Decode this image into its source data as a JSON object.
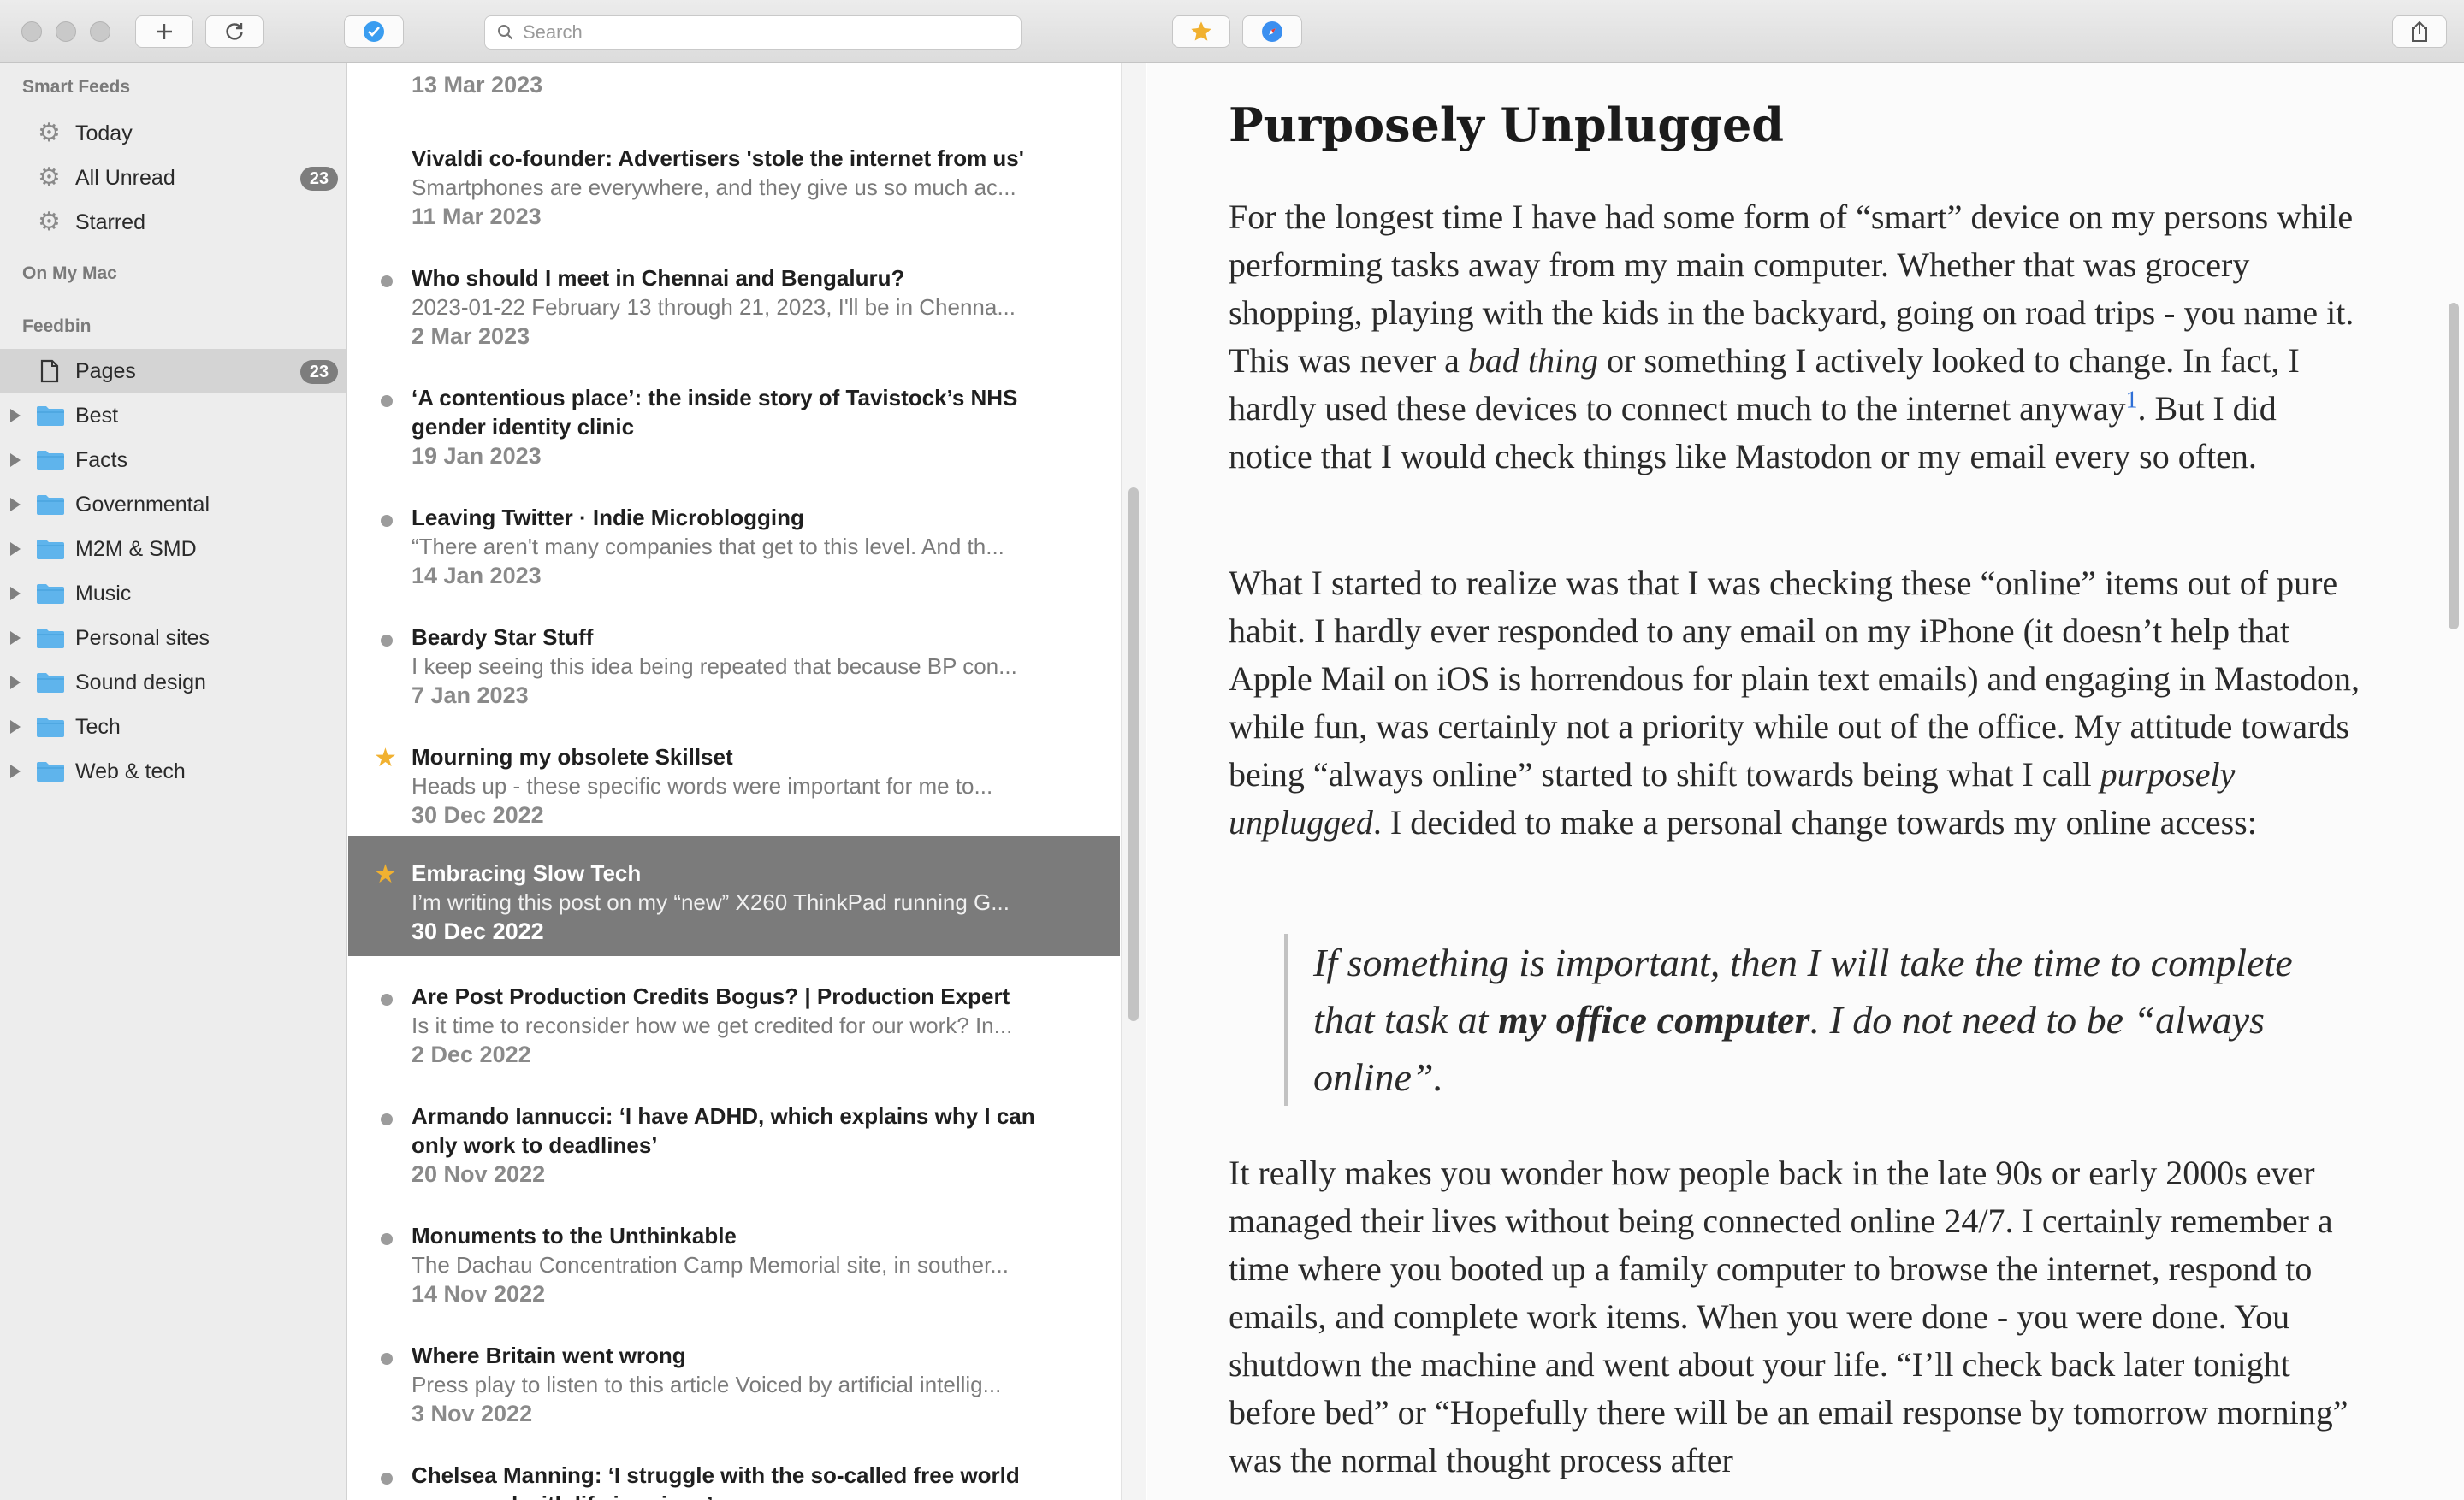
{
  "toolbar": {
    "search_placeholder": "Search",
    "new_icon": "plus-icon",
    "refresh_icon": "refresh-icon",
    "mark_read_icon": "checkmark-circle-icon",
    "star_icon": "star-icon",
    "safari_icon": "compass-icon",
    "share_icon": "share-icon"
  },
  "sidebar": {
    "sections": {
      "smart_feeds": "Smart Feeds",
      "on_my_mac": "On My Mac",
      "feedbin": "Feedbin"
    },
    "smart_items": [
      {
        "label": "Today",
        "badge": ""
      },
      {
        "label": "All Unread",
        "badge": "23"
      },
      {
        "label": "Starred",
        "badge": ""
      }
    ],
    "pages": {
      "label": "Pages",
      "badge": "23"
    },
    "folders": [
      {
        "label": "Best"
      },
      {
        "label": "Facts"
      },
      {
        "label": "Governmental"
      },
      {
        "label": "M2M & SMD"
      },
      {
        "label": "Music"
      },
      {
        "label": "Personal sites"
      },
      {
        "label": "Sound design"
      },
      {
        "label": "Tech"
      },
      {
        "label": "Web & tech"
      }
    ]
  },
  "articles": [
    {
      "date": "13 Mar 2023"
    },
    {
      "title": "Vivaldi co-founder: Advertisers 'stole the internet from us'",
      "excerpt": "Smartphones are everywhere, and they give us so much ac...",
      "date": "11 Mar 2023",
      "marker": "none"
    },
    {
      "title": "Who should I meet in Chennai and Bengaluru?",
      "excerpt": "2023-01-22 February 13 through 21, 2023, I'll be in Chenna...",
      "date": "2 Mar 2023",
      "marker": "unread"
    },
    {
      "title": "‘A contentious place’: the inside story of Tavistock’s NHS",
      "title2": "gender identity clinic",
      "date": "19 Jan 2023",
      "marker": "unread"
    },
    {
      "title": "Leaving Twitter · Indie Microblogging",
      "excerpt": "“There aren't many companies that get to this level. And th...",
      "date": "14 Jan 2023",
      "marker": "unread"
    },
    {
      "title": "Beardy Star Stuff",
      "excerpt": "I keep seeing this idea being repeated that because BP con...",
      "date": "7 Jan 2023",
      "marker": "unread"
    },
    {
      "title": "Mourning my obsolete Skillset",
      "excerpt": "Heads up - these specific words were important for me to...",
      "date": "30 Dec 2022",
      "marker": "starred"
    },
    {
      "title": "Embracing Slow Tech",
      "excerpt": "I’m writing this post on my “new” X260 ThinkPad running G...",
      "date": "30 Dec 2022",
      "marker": "starred",
      "selected": true
    },
    {
      "title": "Are Post Production Credits Bogus? | Production Expert",
      "excerpt": "Is it time to reconsider how we get credited for our work? In...",
      "date": "2 Dec 2022",
      "marker": "unread"
    },
    {
      "title": "Armando Iannucci: ‘I have ADHD, which explains why I can",
      "title2": "only work to deadlines’",
      "date": "20 Nov 2022",
      "marker": "unread"
    },
    {
      "title": "Monuments to the Unthinkable",
      "excerpt": "The Dachau Concentration Camp Memorial site, in souther...",
      "date": "14 Nov 2022",
      "marker": "unread"
    },
    {
      "title": "Where Britain went wrong",
      "excerpt": "Press play to listen to this article Voiced by artificial intellig...",
      "date": "3 Nov 2022",
      "marker": "unread"
    },
    {
      "title": "Chelsea Manning: ‘I struggle with the so-called free world",
      "title2": "compared with life in prison’",
      "marker": "unread"
    }
  ],
  "article": {
    "title": "Purposely Unplugged",
    "p1_a": "For the longest time I have had some form of “smart” device on my persons while performing tasks away from my main computer. Whether that was grocery shopping, playing with the kids in the backyard, going on road trips - you name it. This was never a ",
    "p1_em": "bad thing",
    "p1_b": " or something I actively looked to change. In fact, I hardly used these devices to connect much to the internet anyway",
    "p1_fn": "1",
    "p1_c": ". But I did notice that I would check things like Mastodon or my email every so often.",
    "p2_a": "What I started to realize was that I was checking these “online” items out of pure habit. I hardly ever responded to any email on my iPhone (it doesn’t help that Apple Mail on iOS is horrendous for plain text emails) and engaging in Mastodon, while fun, was certainly not a priority while out of the office. My attitude towards being “always online” started to shift towards being what I call ",
    "p2_em": "purposely unplugged",
    "p2_b": ". I decided to make a personal change towards my online access:",
    "q_a": "If something is important, then I will take the time to complete that task at ",
    "q_strong": "my office computer",
    "q_b": ". I do not need to be “always online”.",
    "p3": "It really makes you wonder how people back in the late 90s or early 2000s ever managed their lives without being connected online 24/7. I certainly remember a time where you booted up a family computer to browse the internet, respond to emails, and complete work items. When you were done - you were done. You shutdown the machine and went about your life. “I’ll check back later tonight before bed” or “Hopefully there will be an email response by tomorrow morning” was the normal thought process after"
  },
  "colors": {
    "accent_star": "#f1b130",
    "selection": "#7b7b7b",
    "badge": "#7d7d7d",
    "folder": "#5fb4ec",
    "link": "#2f6fd6"
  }
}
